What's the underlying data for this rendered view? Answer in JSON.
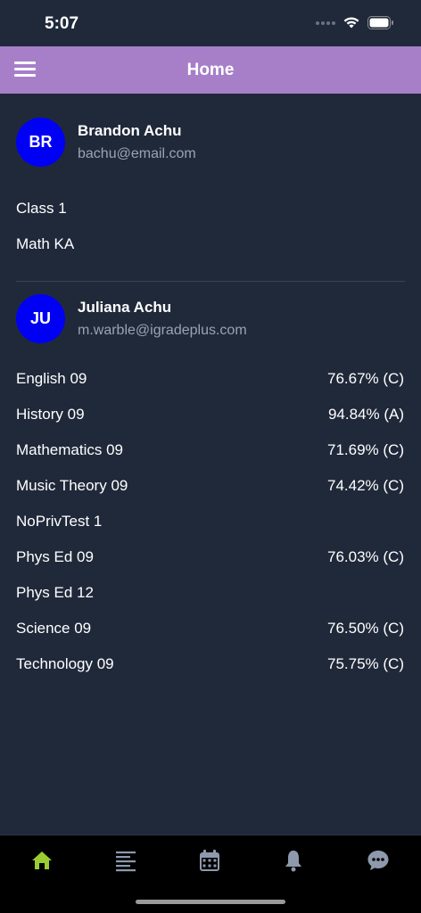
{
  "status": {
    "time": "5:07"
  },
  "header": {
    "title": "Home",
    "menu_icon": "hamburger-menu-icon"
  },
  "users": [
    {
      "initials": "BR",
      "name": "Brandon Achu",
      "email": "bachu@email.com",
      "avatar_color": "#0000f5",
      "classes": [
        {
          "name": "Class 1",
          "grade": ""
        },
        {
          "name": "Math KA",
          "grade": ""
        }
      ]
    },
    {
      "initials": "JU",
      "name": "Juliana Achu",
      "email": "m.warble@igradeplus.com",
      "avatar_color": "#0000f5",
      "classes": [
        {
          "name": "English 09",
          "grade": "76.67% (C)"
        },
        {
          "name": "History 09",
          "grade": "94.84% (A)"
        },
        {
          "name": "Mathematics 09",
          "grade": "71.69% (C)"
        },
        {
          "name": "Music Theory 09",
          "grade": "74.42% (C)"
        },
        {
          "name": "NoPrivTest 1",
          "grade": ""
        },
        {
          "name": "Phys Ed 09",
          "grade": "76.03% (C)"
        },
        {
          "name": "Phys Ed 12",
          "grade": ""
        },
        {
          "name": "Science 09",
          "grade": "76.50% (C)"
        },
        {
          "name": "Technology 09",
          "grade": "75.75% (C)"
        }
      ]
    }
  ],
  "bottom_nav": [
    {
      "icon": "home-icon",
      "active": true
    },
    {
      "icon": "list-icon",
      "active": false
    },
    {
      "icon": "calendar-icon",
      "active": false
    },
    {
      "icon": "bell-icon",
      "active": false
    },
    {
      "icon": "chat-icon",
      "active": false
    }
  ],
  "colors": {
    "background": "#20293a",
    "header": "#a77fc9",
    "avatar": "#0000f5",
    "nav_active": "#9acd32",
    "nav_inactive": "#8e99ad"
  }
}
